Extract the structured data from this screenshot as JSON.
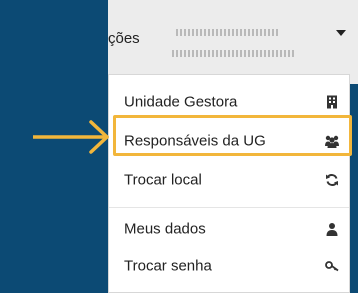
{
  "header": {
    "partial_nav_label": "ções",
    "user_name_redacted": true
  },
  "menu": {
    "items": [
      {
        "label": "Unidade Gestora",
        "icon": "building-icon"
      },
      {
        "label": "Responsáveis da UG",
        "icon": "users-icon"
      },
      {
        "label": "Trocar local",
        "icon": "sync-icon"
      },
      {
        "label": "Meus dados",
        "icon": "user-icon"
      },
      {
        "label": "Trocar senha",
        "icon": "key-icon"
      }
    ],
    "highlighted_index": 1
  },
  "annotation": {
    "arrow": "right-arrow-icon",
    "color": "#f2b63b"
  },
  "colors": {
    "background": "#0c4a74",
    "header": "#ececec",
    "highlight": "#f2b63b"
  }
}
